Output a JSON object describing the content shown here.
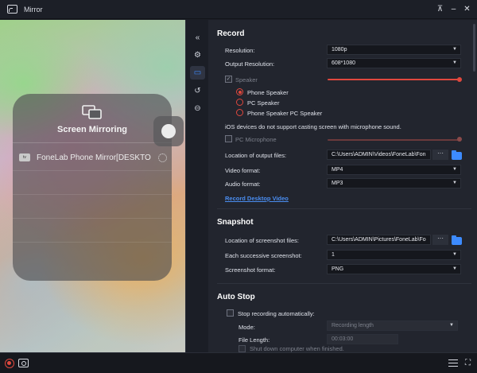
{
  "window": {
    "title": "Mirror",
    "controls": [
      "pin",
      "minimize",
      "close"
    ]
  },
  "preview": {
    "panel_title": "Screen Mirroring",
    "device_badge": "tv",
    "device_name": "FoneLab Phone Mirror[DESKTO"
  },
  "sidenav": {
    "items": [
      {
        "icon": "collapse-icon",
        "glyph": "«"
      },
      {
        "icon": "gear-icon",
        "glyph": "⚙"
      },
      {
        "icon": "record-video-icon",
        "glyph": "▭"
      },
      {
        "icon": "history-icon",
        "glyph": "↺"
      },
      {
        "icon": "minus-circle-icon",
        "glyph": "⊖"
      }
    ],
    "active_index": 2
  },
  "record": {
    "title": "Record",
    "resolution_label": "Resolution:",
    "resolution_value": "1080p",
    "output_resolution_label": "Output Resolution:",
    "output_resolution_value": "608*1080",
    "speaker_label": "Speaker",
    "speaker_volume": 1.0,
    "speaker_options": [
      "Phone Speaker",
      "PC Speaker",
      "Phone Speaker  PC Speaker"
    ],
    "speaker_selected": 0,
    "ios_note": "iOS devices do not support casting screen with microphone sound.",
    "pc_microphone_label": "PC Microphone",
    "output_files_label": "Location of output files:",
    "output_files_path": "C:\\Users\\ADMIN\\Videos\\FoneLab\\Fon",
    "more_label": "···",
    "video_format_label": "Video format:",
    "video_format_value": "MP4",
    "audio_format_label": "Audio format:",
    "audio_format_value": "MP3",
    "desktop_video_link": "Record Desktop Video"
  },
  "snapshot": {
    "title": "Snapshot",
    "screenshot_files_label": "Location of screenshot files:",
    "screenshot_files_path": "C:\\Users\\ADMIN\\Pictures\\FoneLab\\Fo",
    "more_label": "···",
    "successive_label": "Each successive screenshot:",
    "successive_value": "1",
    "format_label": "Screenshot format:",
    "format_value": "PNG"
  },
  "autostop": {
    "title": "Auto Stop",
    "stop_auto_label": "Stop recording automatically:",
    "mode_label": "Mode:",
    "mode_value": "Recording length",
    "file_length_label": "File Length:",
    "file_length_value": "00:03:00",
    "shutdown_label": "Shut down computer when finished."
  },
  "colors": {
    "accent_blue": "#3d8bff",
    "accent_red": "#e0483e",
    "panel_bg": "#22252e"
  }
}
